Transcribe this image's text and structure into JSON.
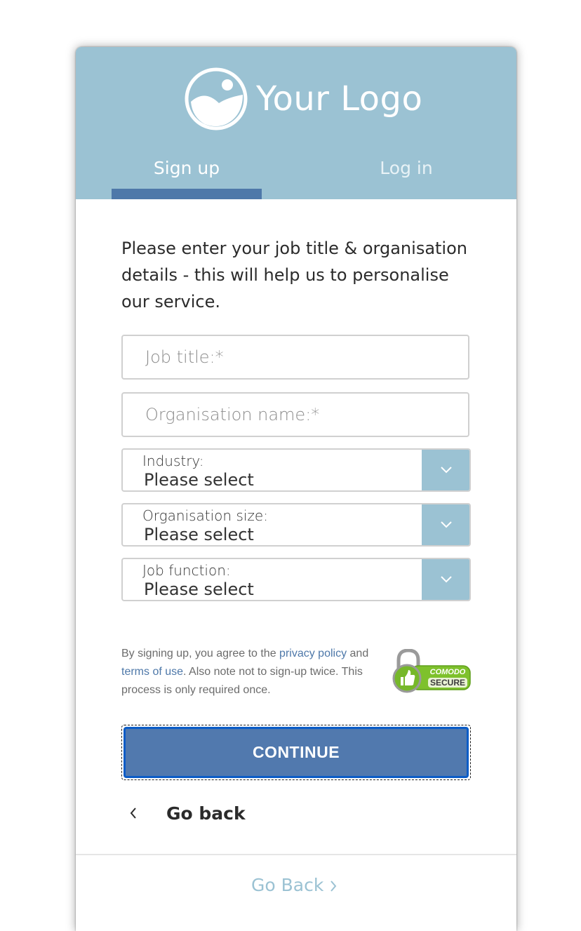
{
  "brand": {
    "logo_text": "Your Logo",
    "header_color": "#9bc2d3",
    "accent_color": "#4e78a9"
  },
  "tabs": [
    {
      "label": "Sign up",
      "active": true
    },
    {
      "label": "Log in",
      "active": false
    }
  ],
  "intro_text": "Please enter your job title & organisation details - this will help us to personalise our service.",
  "fields": {
    "job_title": {
      "placeholder": "Job title:*",
      "value": ""
    },
    "organisation_name": {
      "placeholder": "Organisation name:*",
      "value": ""
    }
  },
  "selects": [
    {
      "label": "Industry:",
      "value": "Please select"
    },
    {
      "label": "Organisation size:",
      "value": "Please select"
    },
    {
      "label": "Job function:",
      "value": "Please select"
    }
  ],
  "terms": {
    "prefix": "By signing up, you agree to the ",
    "privacy_link": "privacy policy",
    "middle": " and ",
    "terms_link": "terms of use",
    "suffix": ". Also note not to sign-up twice. This process is only required once."
  },
  "badge": {
    "line1": "COMODO",
    "line2": "SECURE"
  },
  "continue_label": "CONTINUE",
  "go_back_label": "Go back",
  "footer_link_label": "Go Back"
}
